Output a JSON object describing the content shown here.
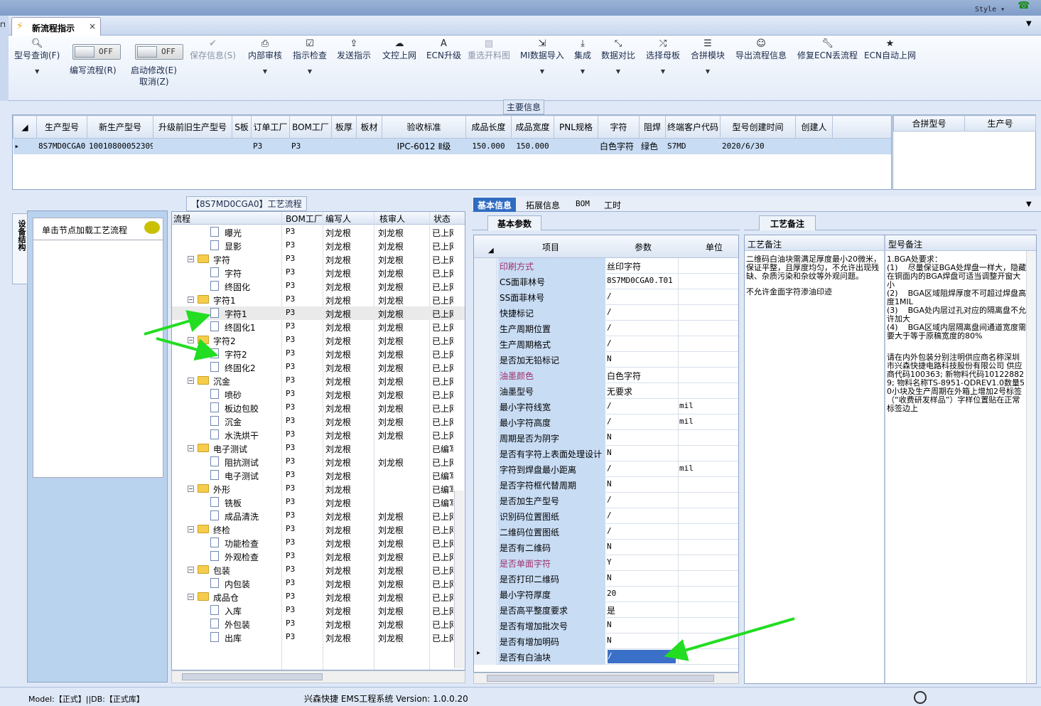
{
  "window": {
    "style_label": "Style",
    "tab_label": "新流程指示",
    "close_glyph": "×"
  },
  "toolbar": {
    "model_query": "型号查询(F)",
    "write_flow": "编写流程(R)",
    "enable_modify": "启动修改(E)",
    "cancel": "取消(Z)",
    "toggle_off": "OFF",
    "save_info": "保存信息(S)",
    "internal_review": "内部审核",
    "instruction_check": "指示检查",
    "send_instruction": "发送指示",
    "doc_upload": "文控上网",
    "ecn_upgrade": "ECN升级",
    "reselect_cut": "重选开料图",
    "mi_import": "MI数据导入",
    "integrate": "集成",
    "data_compare": "数据对比",
    "select_mother": "选择母板",
    "merge_module": "合拼模块",
    "export_flow": "导出流程信息",
    "fix_ecn": "修复ECN丢流程",
    "ecn_auto_upload": "ECN自动上网"
  },
  "main_info": {
    "title": "主要信息",
    "columns": [
      "生产型号",
      "新生产型号",
      "升级前旧生产型号",
      "S板",
      "订单工厂",
      "BOM工厂",
      "板厚",
      "板材",
      "验收标准",
      "成品长度",
      "成品宽度",
      "PNL规格",
      "字符",
      "阻焊",
      "终端客户代码",
      "型号创建时间",
      "创建人"
    ],
    "row": [
      "8S7MD0CGA0",
      "10010800052309",
      "",
      "",
      "P3",
      "P3",
      "",
      "",
      "IPC-6012 Ⅱ级",
      "150.000",
      "150.000",
      "",
      "白色字符",
      "绿色",
      "S7MD",
      "2020/6/30",
      ""
    ],
    "side_columns": [
      "合拼型号",
      "生产号"
    ]
  },
  "flow_panel": {
    "title": "【8S7MD0CGA0】工艺流程",
    "vertical_tab": "设备结构",
    "hint": "单击节点加载工艺流程",
    "columns": [
      "流程",
      "BOM工厂",
      "编写人",
      "核审人",
      "状态"
    ],
    "rows": [
      {
        "name": "曝光",
        "level": 2,
        "bom": "P3",
        "writer": "刘龙根",
        "reviewer": "刘龙根",
        "status": "已上网"
      },
      {
        "name": "显影",
        "level": 2,
        "bom": "P3",
        "writer": "刘龙根",
        "reviewer": "刘龙根",
        "status": "已上网"
      },
      {
        "name": "字符",
        "level": 1,
        "bom": "P3",
        "writer": "刘龙根",
        "reviewer": "刘龙根",
        "status": "已上网"
      },
      {
        "name": "字符",
        "level": 2,
        "bom": "P3",
        "writer": "刘龙根",
        "reviewer": "刘龙根",
        "status": "已上网"
      },
      {
        "name": "终固化",
        "level": 2,
        "bom": "P3",
        "writer": "刘龙根",
        "reviewer": "刘龙根",
        "status": "已上网"
      },
      {
        "name": "字符1",
        "level": 1,
        "bom": "P3",
        "writer": "刘龙根",
        "reviewer": "刘龙根",
        "status": "已上网"
      },
      {
        "name": "字符1",
        "level": 2,
        "bom": "P3",
        "writer": "刘龙根",
        "reviewer": "刘龙根",
        "status": "已上网",
        "highlight": true
      },
      {
        "name": "终固化1",
        "level": 2,
        "bom": "P3",
        "writer": "刘龙根",
        "reviewer": "刘龙根",
        "status": "已上网"
      },
      {
        "name": "字符2",
        "level": 1,
        "bom": "P3",
        "writer": "刘龙根",
        "reviewer": "刘龙根",
        "status": "已上网"
      },
      {
        "name": "字符2",
        "level": 2,
        "bom": "P3",
        "writer": "刘龙根",
        "reviewer": "刘龙根",
        "status": "已上网"
      },
      {
        "name": "终固化2",
        "level": 2,
        "bom": "P3",
        "writer": "刘龙根",
        "reviewer": "刘龙根",
        "status": "已上网"
      },
      {
        "name": "沉金",
        "level": 1,
        "bom": "P3",
        "writer": "刘龙根",
        "reviewer": "刘龙根",
        "status": "已上网"
      },
      {
        "name": "喷砂",
        "level": 2,
        "bom": "P3",
        "writer": "刘龙根",
        "reviewer": "刘龙根",
        "status": "已上网"
      },
      {
        "name": "板边包胶",
        "level": 2,
        "bom": "P3",
        "writer": "刘龙根",
        "reviewer": "刘龙根",
        "status": "已上网"
      },
      {
        "name": "沉金",
        "level": 2,
        "bom": "P3",
        "writer": "刘龙根",
        "reviewer": "刘龙根",
        "status": "已上网"
      },
      {
        "name": "水洗烘干",
        "level": 2,
        "bom": "P3",
        "writer": "刘龙根",
        "reviewer": "刘龙根",
        "status": "已上网"
      },
      {
        "name": "电子测试",
        "level": 1,
        "bom": "P3",
        "writer": "刘龙根",
        "reviewer": "",
        "status": "已编写"
      },
      {
        "name": "阻抗测试",
        "level": 2,
        "bom": "P3",
        "writer": "刘龙根",
        "reviewer": "刘龙根",
        "status": "已上网"
      },
      {
        "name": "电子测试",
        "level": 2,
        "bom": "P3",
        "writer": "刘龙根",
        "reviewer": "",
        "status": "已编写"
      },
      {
        "name": "外形",
        "level": 1,
        "bom": "P3",
        "writer": "刘龙根",
        "reviewer": "",
        "status": "已编写"
      },
      {
        "name": "铣板",
        "level": 2,
        "bom": "P3",
        "writer": "刘龙根",
        "reviewer": "",
        "status": "已编写"
      },
      {
        "name": "成品清洗",
        "level": 2,
        "bom": "P3",
        "writer": "刘龙根",
        "reviewer": "刘龙根",
        "status": "已上网"
      },
      {
        "name": "终检",
        "level": 1,
        "bom": "P3",
        "writer": "刘龙根",
        "reviewer": "刘龙根",
        "status": "已上网"
      },
      {
        "name": "功能检查",
        "level": 2,
        "bom": "P3",
        "writer": "刘龙根",
        "reviewer": "刘龙根",
        "status": "已上网"
      },
      {
        "name": "外观检查",
        "level": 2,
        "bom": "P3",
        "writer": "刘龙根",
        "reviewer": "刘龙根",
        "status": "已上网"
      },
      {
        "name": "包装",
        "level": 1,
        "bom": "P3",
        "writer": "刘龙根",
        "reviewer": "刘龙根",
        "status": "已上网"
      },
      {
        "name": "内包装",
        "level": 2,
        "bom": "P3",
        "writer": "刘龙根",
        "reviewer": "刘龙根",
        "status": "已上网"
      },
      {
        "name": "成品仓",
        "level": 1,
        "bom": "P3",
        "writer": "刘龙根",
        "reviewer": "刘龙根",
        "status": "已上网"
      },
      {
        "name": "入库",
        "level": 2,
        "bom": "P3",
        "writer": "刘龙根",
        "reviewer": "刘龙根",
        "status": "已上网"
      },
      {
        "name": "外包装",
        "level": 2,
        "bom": "P3",
        "writer": "刘龙根",
        "reviewer": "刘龙根",
        "status": "已上网"
      },
      {
        "name": "出库",
        "level": 2,
        "bom": "P3",
        "writer": "刘龙根",
        "reviewer": "刘龙根",
        "status": "已上网"
      }
    ]
  },
  "right_tabs": [
    "基本信息",
    "拓展信息",
    "BOM",
    "工时"
  ],
  "params": {
    "tab": "基本参数",
    "columns": [
      "项目",
      "参数",
      "单位"
    ],
    "rows": [
      {
        "item": "印刷方式",
        "value": "丝印字符",
        "unit": "",
        "pink": true
      },
      {
        "item": "CS面菲林号",
        "value": "8S7MD0CGA0.T01",
        "unit": ""
      },
      {
        "item": "SS面菲林号",
        "value": "/",
        "unit": ""
      },
      {
        "item": "快捷标记",
        "value": "/",
        "unit": ""
      },
      {
        "item": "生产周期位置",
        "value": "/",
        "unit": ""
      },
      {
        "item": "生产周期格式",
        "value": "/",
        "unit": ""
      },
      {
        "item": "是否加无铅标记",
        "value": "N",
        "unit": ""
      },
      {
        "item": "油墨颜色",
        "value": "白色字符",
        "unit": "",
        "pink": true
      },
      {
        "item": "油墨型号",
        "value": "无要求",
        "unit": ""
      },
      {
        "item": "最小字符线宽",
        "value": "/",
        "unit": "mil"
      },
      {
        "item": "最小字符高度",
        "value": "/",
        "unit": "mil"
      },
      {
        "item": "周期是否为阴字",
        "value": "N",
        "unit": ""
      },
      {
        "item": "是否有字符上表面处理设计",
        "value": "N",
        "unit": ""
      },
      {
        "item": "字符到焊盘最小距离",
        "value": "/",
        "unit": "mil"
      },
      {
        "item": "是否字符框代替周期",
        "value": "N",
        "unit": ""
      },
      {
        "item": "是否加生产型号",
        "value": "/",
        "unit": ""
      },
      {
        "item": "识别码位置图纸",
        "value": "/",
        "unit": ""
      },
      {
        "item": "二维码位置图纸",
        "value": "/",
        "unit": ""
      },
      {
        "item": "是否有二维码",
        "value": "N",
        "unit": ""
      },
      {
        "item": "是否单面字符",
        "value": "Y",
        "unit": "",
        "pink": true
      },
      {
        "item": "是否打印二维码",
        "value": "N",
        "unit": ""
      },
      {
        "item": "最小字符厚度",
        "value": "20",
        "unit": ""
      },
      {
        "item": "是否高平整度要求",
        "value": "是",
        "unit": ""
      },
      {
        "item": "是否有增加批次号",
        "value": "N",
        "unit": ""
      },
      {
        "item": "是否有增加明码",
        "value": "N",
        "unit": ""
      },
      {
        "item": "是否有白油块",
        "value": "/",
        "unit": "",
        "selected": true
      }
    ]
  },
  "memo": {
    "tab": "工艺备注",
    "col1_title": "工艺备注",
    "col2_title": "型号备注",
    "col1_paras": [
      "二维码白油块需满足厚度最小20微米，保证平整，且厚度均匀，不允许出现残缺、杂质污染和杂纹等外观问题。",
      "不允许金面字符渗油印迹"
    ],
    "col2_paras": [
      "1.BGA处要求：\n(1)    尽量保证BGA处焊盘一样大，隐藏在铜面内的BGA焊盘可适当调整开窗大小\n(2)    BGA区域阻焊厚度不可超过焊盘高度1MIL\n(3)    BGA处内层过孔对应的隔离盘不允许加大\n(4)    BGA区域内层隔离盘间通道宽度需要大于等于原稿宽度的80%",
      "请在内外包装分别注明供应商名称深圳市兴森快捷电路科技股份有限公司 供应商代码100363; 新物料代码101228829; 物料名称TS-8951-QDREV1.0数量50小块及生产周期在外箱上增加2号标签（“收费研发样品”）字样位置贴在正常标签边上"
    ]
  },
  "status": {
    "model_db": "Model:【正式】||DB:【正式库】",
    "app": "兴森快捷 EMS工程系统 Version: 1.0.0.20"
  }
}
